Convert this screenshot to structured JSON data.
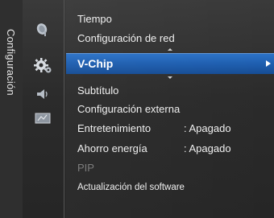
{
  "sidebar": {
    "title": "Configuración"
  },
  "icons": [
    "satellite-dish-icon",
    "gear-icon",
    "speaker-icon",
    "input-icon"
  ],
  "menu": {
    "items": [
      {
        "label": "Tiempo"
      },
      {
        "label": "Configuración de red"
      },
      {
        "label": "V-Chip",
        "selected": true
      },
      {
        "label": "Subtítulo"
      },
      {
        "label": "Configuración externa"
      },
      {
        "label": "Entretenimiento",
        "value": ": Apagado"
      },
      {
        "label": "Ahorro energía",
        "value": ": Apagado"
      },
      {
        "label": "PIP",
        "disabled": true
      },
      {
        "label": "Actualización del software"
      }
    ]
  },
  "colors": {
    "highlight": "#1f5fb0",
    "background": "#2b2b2b",
    "text": "#f0f0f0",
    "disabled_text": "#7a7a7a"
  }
}
